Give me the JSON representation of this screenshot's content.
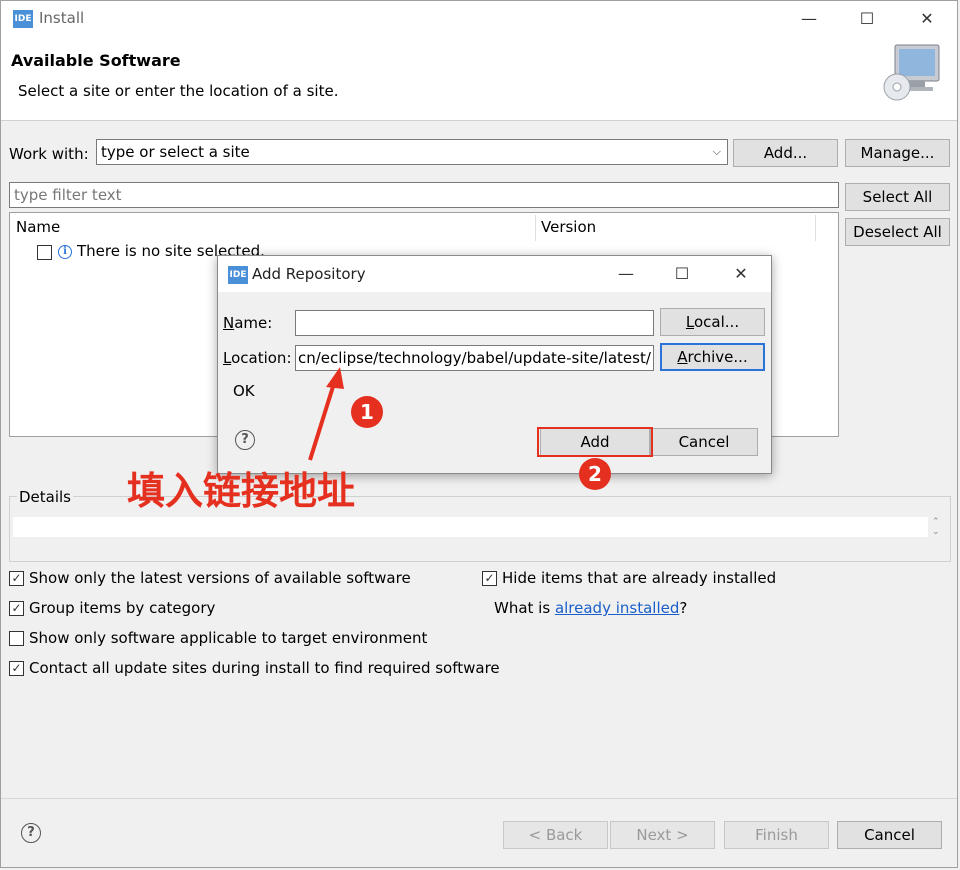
{
  "window": {
    "title": "Install",
    "icon_text": "IDE",
    "controls": [
      "—",
      "☐",
      "✕"
    ]
  },
  "header": {
    "title": "Available Software",
    "subtitle": "Select a site or enter the location of a site."
  },
  "work_with": {
    "label": "Work with:",
    "value": "type or select a site",
    "add_label": "Add...",
    "manage_label": "Manage..."
  },
  "filter": {
    "placeholder": "type filter text",
    "select_all": "Select All",
    "deselect_all": "Deselect All"
  },
  "table": {
    "columns": [
      "Name",
      "Version"
    ],
    "rows": [
      {
        "checked": false,
        "icon": "info-icon",
        "name": "There is no site selected."
      }
    ]
  },
  "details": {
    "label": "Details"
  },
  "options": {
    "latest_versions": {
      "label": "Show only the latest versions of available software",
      "checked": true
    },
    "group_category": {
      "label": "Group items by category",
      "checked": true
    },
    "target_env": {
      "label": "Show only software applicable to target environment",
      "checked": false
    },
    "contact_sites": {
      "label": "Contact all update sites during install to find required software",
      "checked": true
    },
    "hide_installed": {
      "label": "Hide items that are already installed",
      "checked": true
    },
    "what_is_prefix": "What is ",
    "what_is_link": "already installed",
    "what_is_suffix": "?"
  },
  "footer": {
    "back": "< Back",
    "next": "Next >",
    "finish": "Finish",
    "cancel": "Cancel"
  },
  "dialog": {
    "title": "Add Repository",
    "icon_text": "IDE",
    "name_label_u": "N",
    "name_label_rest": "ame:",
    "name_value": "",
    "location_label_u": "L",
    "location_label_rest": "ocation:",
    "location_value": "cn/eclipse/technology/babel/update-site/latest/",
    "local_u": "L",
    "local_rest": "ocal...",
    "archive_u": "A",
    "archive_rest": "rchive...",
    "status": "OK",
    "add_label": "Add",
    "cancel_label": "Cancel",
    "controls": [
      "—",
      "☐",
      "✕"
    ]
  },
  "annotations": {
    "step1": "1",
    "step2": "2",
    "hint": "填入链接地址",
    "color": "#e53020"
  }
}
